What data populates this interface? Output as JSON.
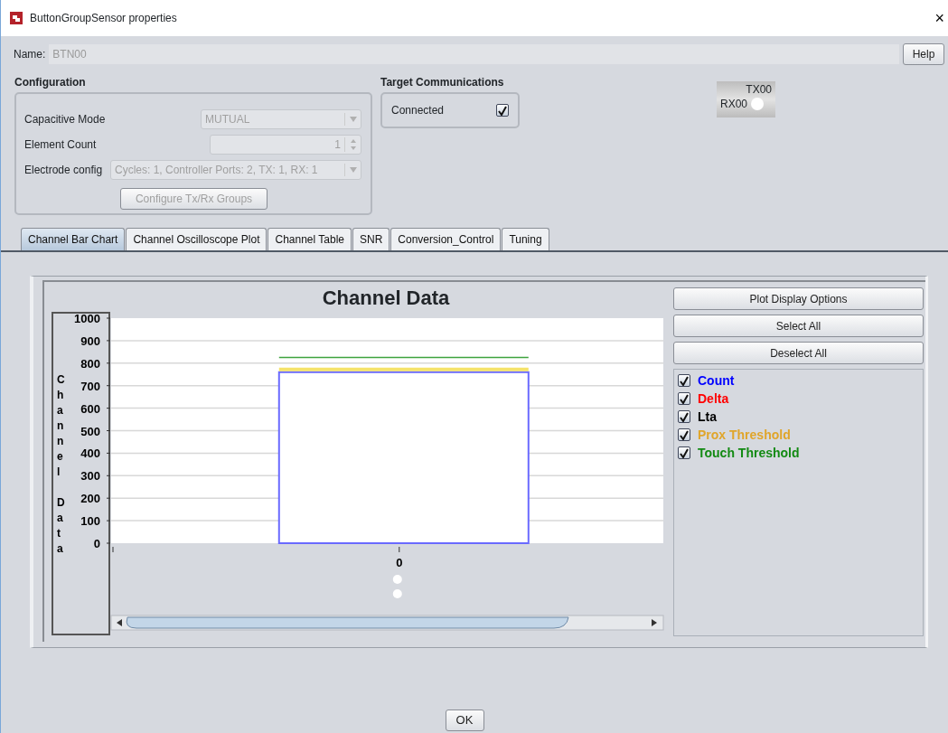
{
  "window": {
    "title": "ButtonGroupSensor properties",
    "close": "×"
  },
  "name_field": {
    "label": "Name:",
    "value": "BTN00",
    "disabled": true
  },
  "help_button": "Help",
  "configuration": {
    "title": "Configuration",
    "fields": [
      {
        "label": "Capacitive Mode",
        "kind": "dropdown",
        "value": "MUTUAL",
        "disabled": true
      },
      {
        "label": "Element Count",
        "kind": "spinner",
        "value": "1",
        "disabled": true
      },
      {
        "label": "Electrode config",
        "kind": "dropdown",
        "value": "Cycles:  1, Controller Ports:  2, TX:  1, RX:  1",
        "disabled": true
      }
    ],
    "button": {
      "label": "Configure Tx/Rx Groups",
      "disabled": true
    }
  },
  "target_communications": {
    "title": "Target Communications",
    "label": "Connected",
    "checked": true
  },
  "element_widget": {
    "tx": "TX00",
    "rx": "RX00"
  },
  "tabs": [
    {
      "label": "Channel Bar Chart",
      "selected": true
    },
    {
      "label": "Channel Oscilloscope Plot",
      "selected": false
    },
    {
      "label": "Channel Table",
      "selected": false
    },
    {
      "label": "SNR",
      "selected": false
    },
    {
      "label": "Conversion_Control",
      "selected": false
    },
    {
      "label": "Tuning",
      "selected": false
    }
  ],
  "chart_panel": {
    "buttons": [
      "Plot Display Options",
      "Select All",
      "Deselect All"
    ],
    "legend": [
      {
        "label": "Count",
        "checked": true,
        "color": "#0000ff"
      },
      {
        "label": "Delta",
        "checked": true,
        "color": "#ff0000"
      },
      {
        "label": "Lta",
        "checked": true,
        "color": "#000000"
      },
      {
        "label": "Prox Threshold",
        "checked": true,
        "color": "#e0a52a"
      },
      {
        "label": "Touch Threshold",
        "checked": true,
        "color": "#138a13"
      }
    ],
    "chart_data": {
      "type": "bar",
      "title": "Channel Data",
      "ylabel": "Channel Data",
      "categories": [
        "0"
      ],
      "ylim": [
        0,
        1000
      ],
      "yticks": [
        0,
        100,
        200,
        300,
        400,
        500,
        600,
        700,
        800,
        900,
        1000
      ],
      "grid": true,
      "series": [
        {
          "color": "#6a6aff",
          "values": [
            760
          ]
        }
      ],
      "ref_lines": [
        {
          "axis": "y",
          "value": 772,
          "color": "#f5e36a"
        },
        {
          "axis": "y",
          "value": 825,
          "color": "#3fa33f"
        }
      ]
    }
  },
  "ok_button": "OK"
}
